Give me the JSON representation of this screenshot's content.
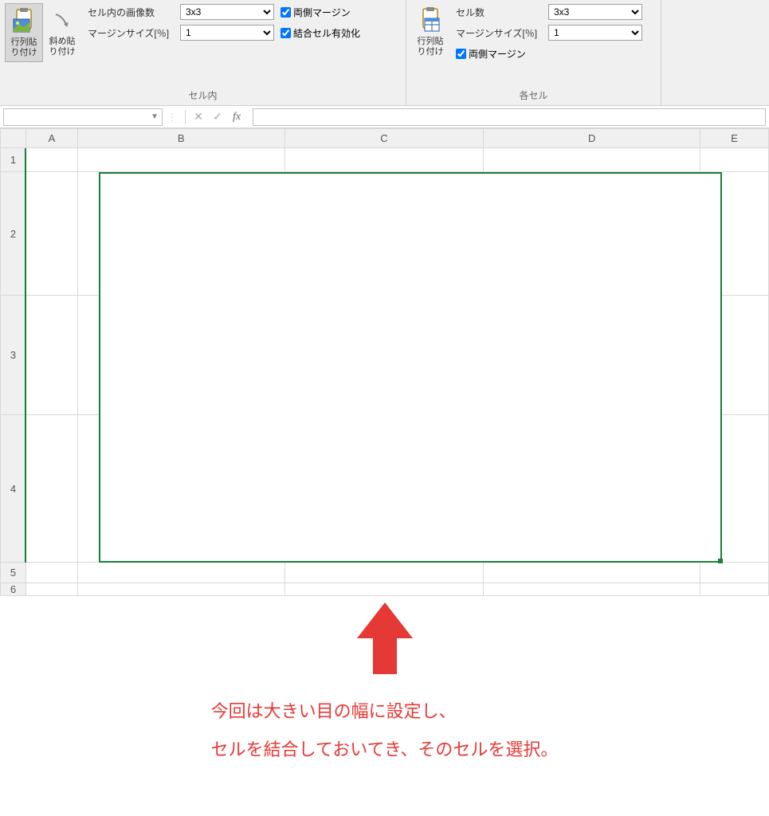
{
  "ribbon": {
    "group1": {
      "button1": "行列貼\nり付け",
      "button2": "斜め貼\nり付け",
      "label_images": "セル内の画像数",
      "select_images": "3x3",
      "label_margin": "マージンサイズ[％]",
      "select_margin": "1",
      "check_both_margin": "両側マージン",
      "check_merge": "結合セル有効化",
      "group_label": "セル内"
    },
    "group2": {
      "button1": "行列貼\nり付け",
      "label_cells": "セル数",
      "select_cells": "3x3",
      "label_margin": "マージンサイズ[％]",
      "select_margin": "1",
      "check_both_margin": "両側マージン",
      "group_label": "各セル"
    }
  },
  "formula_bar": {
    "name_box": "",
    "fx": "fx",
    "formula": ""
  },
  "columns": [
    "A",
    "B",
    "C",
    "D",
    "E"
  ],
  "rows": [
    "1",
    "2",
    "3",
    "4",
    "5",
    "6"
  ],
  "annotation": {
    "line1": "今回は大きい目の幅に設定し、",
    "line2": "セルを結合しておいてき、そのセルを選択。"
  }
}
